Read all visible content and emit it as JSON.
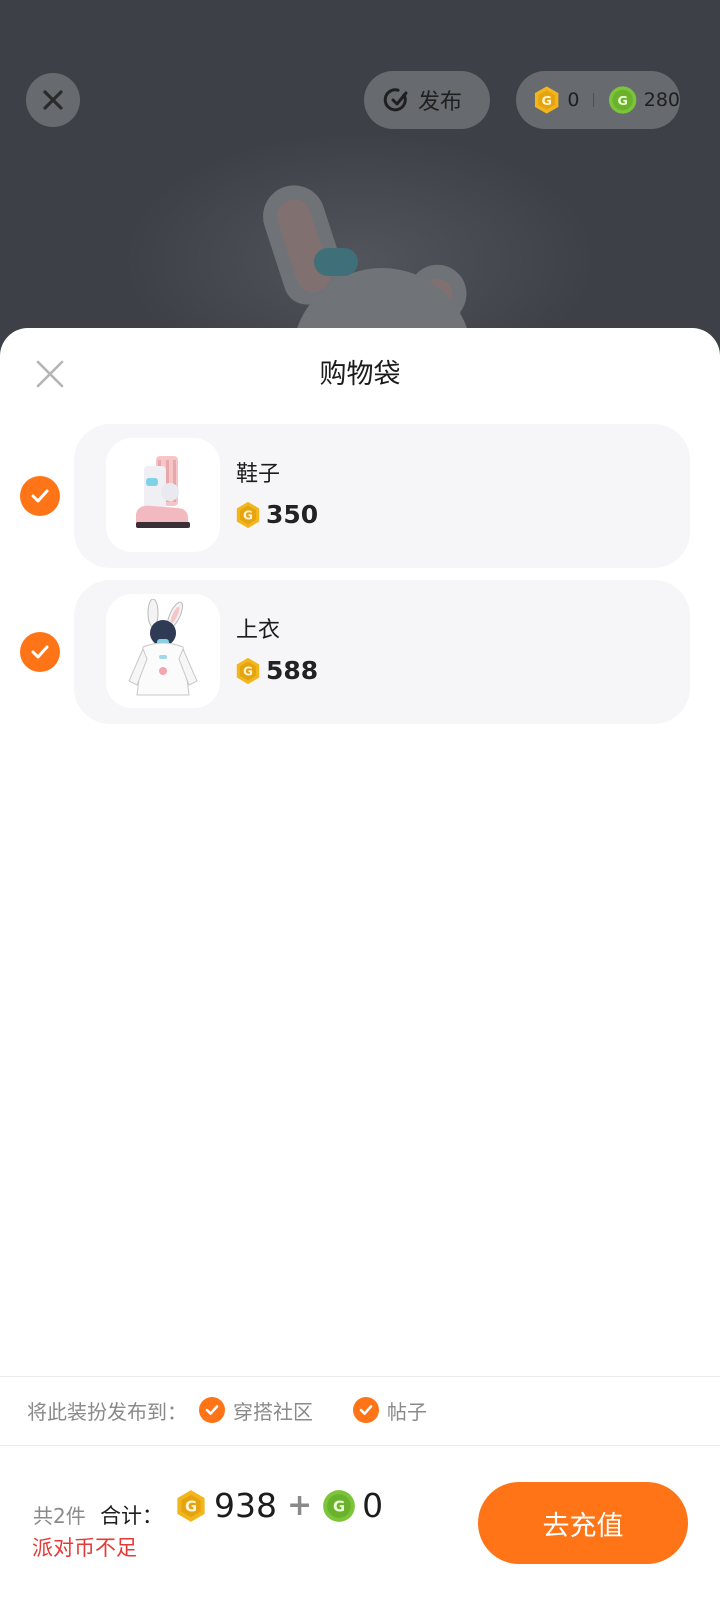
{
  "top_bar": {
    "publish_label": "发布",
    "gold_coins": "0",
    "green_coins": "280"
  },
  "sheet": {
    "title": "购物袋",
    "items": [
      {
        "name": "鞋子",
        "price": "350",
        "selected": true,
        "icon": "shoes-icon"
      },
      {
        "name": "上衣",
        "price": "588",
        "selected": true,
        "icon": "bunny-hoodie-icon"
      }
    ]
  },
  "publish_to": {
    "label": "将此装扮发布到：",
    "options": [
      {
        "label": "穿搭社区",
        "checked": true
      },
      {
        "label": "帖子",
        "checked": true
      }
    ]
  },
  "footer": {
    "count_text": "共2件",
    "total_label": "合计：",
    "gold_total": "938",
    "plus": "+",
    "green_total": "0",
    "warning": "派对币不足",
    "recharge_label": "去充值"
  },
  "colors": {
    "accent": "#ff7417",
    "gold_coin": "#f2b51c",
    "green_coin": "#7cc43a",
    "warning": "#e53935"
  }
}
